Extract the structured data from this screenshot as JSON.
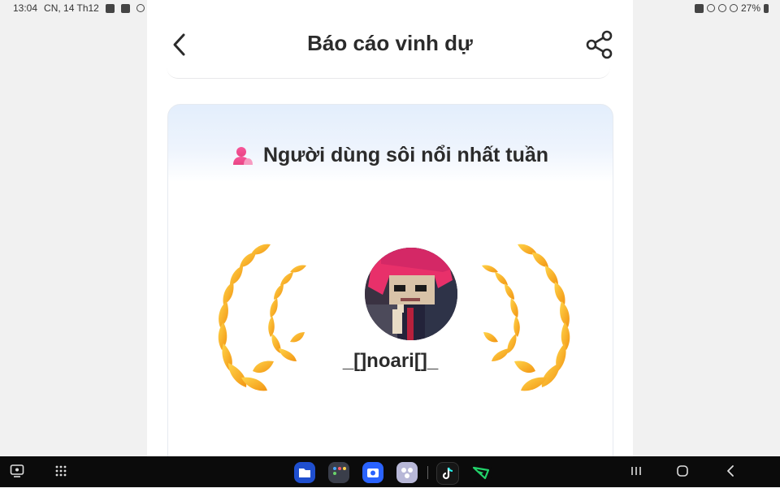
{
  "status_bar": {
    "time": "13:04",
    "date": "CN, 14 Th12",
    "battery": "27%"
  },
  "header": {
    "title": "Báo cáo vinh dự",
    "back_icon": "chevron-left-icon",
    "share_icon": "share-icon"
  },
  "card": {
    "title": "Người dùng sôi nổi nhất tuần",
    "title_icon": "user-icon",
    "username": "_[]noari[]_"
  },
  "colors": {
    "laurel_light": "#ffc83a",
    "laurel_dark": "#f39a12",
    "user_icon": "#ee4f8f",
    "card_gradient_top": "#e3eefc"
  },
  "taskbar": {
    "apps": [
      "files-icon",
      "apps-folder-icon",
      "camera-icon",
      "game-launcher-icon",
      "tiktok-icon",
      "video-player-icon"
    ],
    "nav": [
      "recent-apps-icon",
      "home-icon",
      "back-icon"
    ]
  }
}
